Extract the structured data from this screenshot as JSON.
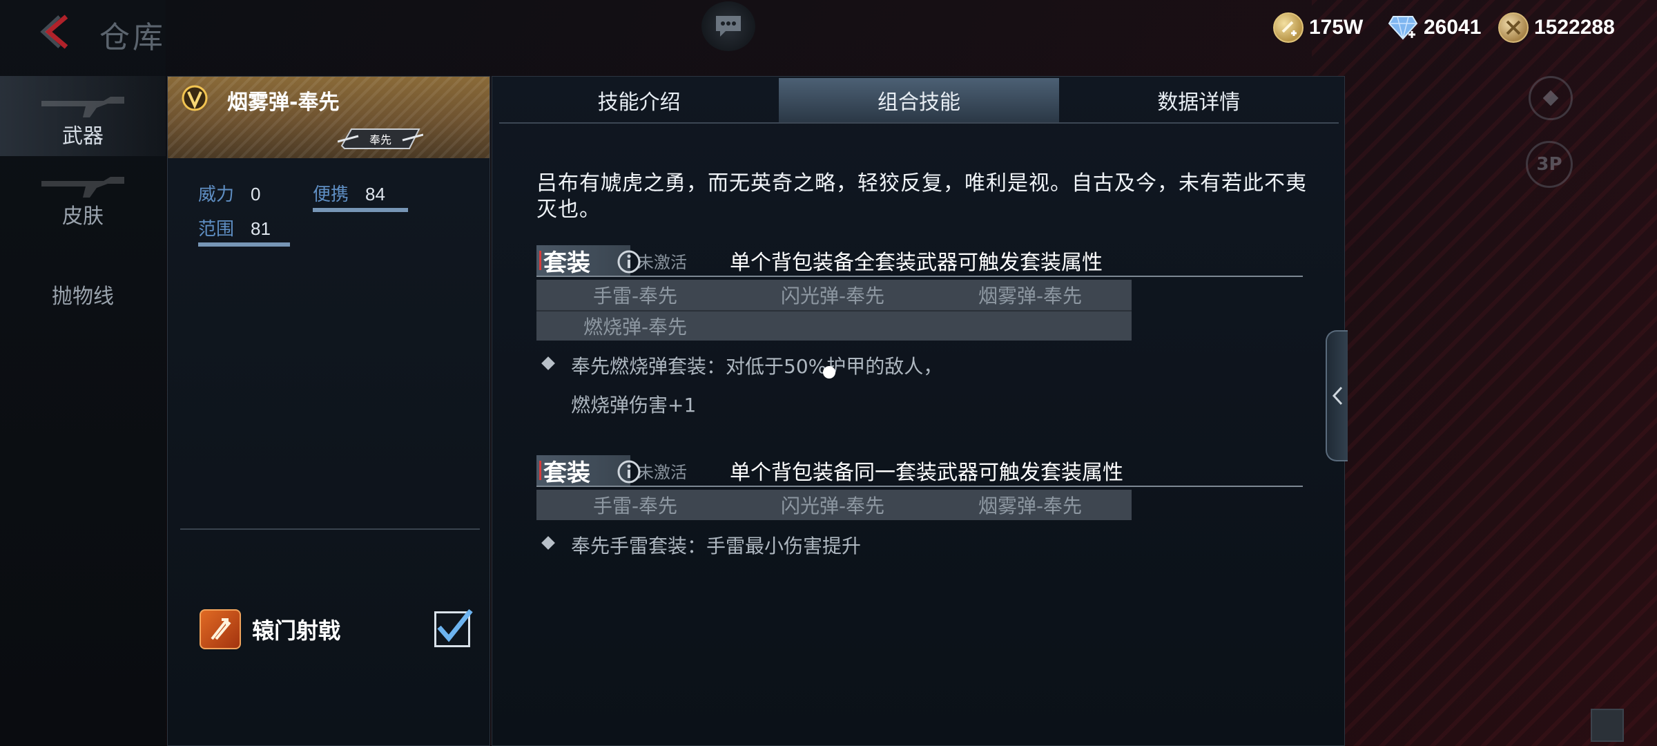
{
  "page": {
    "title": "仓库"
  },
  "currencies": [
    {
      "name": "gold-coin-icon",
      "value": "175W"
    },
    {
      "name": "diamond-icon",
      "value": "26041"
    },
    {
      "name": "token-icon",
      "value": "1522288"
    }
  ],
  "nav": {
    "items": [
      {
        "label": "武器"
      },
      {
        "label": "皮肤"
      },
      {
        "label": "抛物线"
      }
    ]
  },
  "item": {
    "name": "烟雾弹-奉先",
    "emblem_text": "奉先",
    "stats": {
      "power_label": "威力",
      "power_value": "0",
      "power_level": 0,
      "carry_label": "便携",
      "carry_value": "84",
      "carry_level": 0.84,
      "range_label": "范围",
      "range_value": "81",
      "range_level": 0.81
    },
    "skill": {
      "name": "辕门射戟",
      "checked": true
    }
  },
  "tabs": [
    {
      "label": "技能介绍",
      "active": false
    },
    {
      "label": "组合技能",
      "active": true
    },
    {
      "label": "数据详情",
      "active": false
    }
  ],
  "content": {
    "description": "吕布有虓虎之勇，而无英奇之略，轻狡反复，唯利是视。自古及今，未有若此不夷灭也。",
    "suits": [
      {
        "tag": "套装",
        "status": "未激活",
        "rule": "单个背包装备全套装武器可触发套装属性",
        "items": [
          [
            "手雷-奉先",
            "闪光弹-奉先",
            "烟雾弹-奉先"
          ],
          [
            "燃烧弹-奉先"
          ]
        ],
        "effect_line1": "奉先燃烧弹套装：对低于50%护甲的敌人，",
        "effect_line2": "燃烧弹伤害+1"
      },
      {
        "tag": "套装",
        "status": "未激活",
        "rule": "单个背包装备同一套装武器可触发套装属性",
        "items": [
          [
            "手雷-奉先",
            "闪光弹-奉先",
            "烟雾弹-奉先"
          ]
        ],
        "effect_line1": "奉先手雷套装：手雷最小伤害提升"
      }
    ]
  },
  "deco": {
    "view_label": "3P"
  }
}
